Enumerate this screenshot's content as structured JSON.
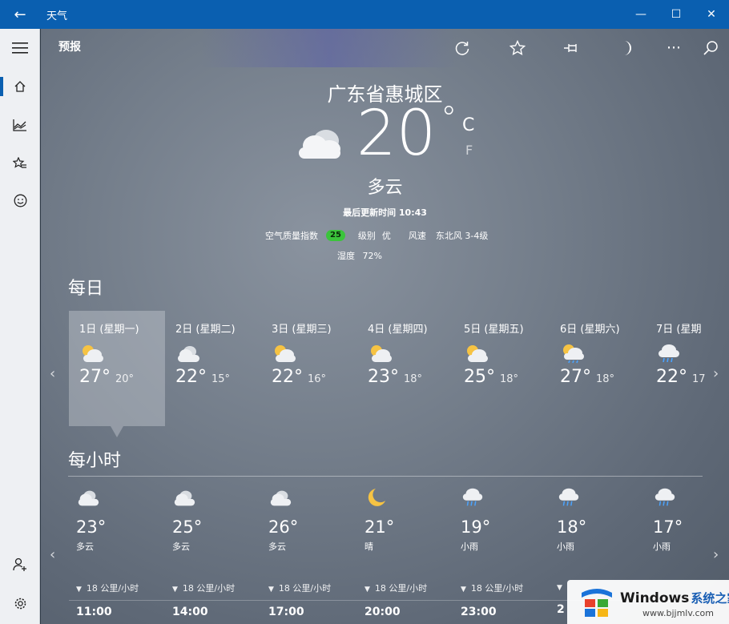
{
  "window": {
    "title": "天气"
  },
  "toolbar": {
    "title": "预报"
  },
  "current": {
    "location": "广东省惠城区",
    "temp": "20",
    "unit_c": "C",
    "unit_f": "F",
    "condition": "多云",
    "updated": "最后更新时间 10:43",
    "aqi_label": "空气质量指数",
    "aqi_value": "25",
    "level_label": "级别",
    "level_value": "优",
    "wind_label": "风速",
    "wind_value": "东北风 3-4级",
    "humidity_label": "湿度",
    "humidity_value": "72%"
  },
  "daily": {
    "title": "每日",
    "days": [
      {
        "label": "1日 (星期一)",
        "icon": "partly-sunny-icon",
        "hi": "27°",
        "lo": "20°"
      },
      {
        "label": "2日 (星期二)",
        "icon": "cloudy-icon",
        "hi": "22°",
        "lo": "15°"
      },
      {
        "label": "3日 (星期三)",
        "icon": "partly-sunny-icon",
        "hi": "22°",
        "lo": "16°"
      },
      {
        "label": "4日 (星期四)",
        "icon": "partly-sunny-icon",
        "hi": "23°",
        "lo": "18°"
      },
      {
        "label": "5日 (星期五)",
        "icon": "partly-sunny-icon",
        "hi": "25°",
        "lo": "18°"
      },
      {
        "label": "6日 (星期六)",
        "icon": "sun-rain-icon",
        "hi": "27°",
        "lo": "18°"
      },
      {
        "label": "7日 (星期",
        "icon": "rain-icon",
        "hi": "22°",
        "lo": "17"
      }
    ]
  },
  "hourly": {
    "title": "每小时",
    "hours": [
      {
        "icon": "cloudy-icon",
        "temp": "23°",
        "desc": "多云",
        "wind": "18 公里/小时",
        "time": "11:00"
      },
      {
        "icon": "cloudy-icon",
        "temp": "25°",
        "desc": "多云",
        "wind": "18 公里/小时",
        "time": "14:00"
      },
      {
        "icon": "cloudy-icon",
        "temp": "26°",
        "desc": "多云",
        "wind": "18 公里/小时",
        "time": "17:00"
      },
      {
        "icon": "moon-icon",
        "temp": "21°",
        "desc": "晴",
        "wind": "18 公里/小时",
        "time": "20:00"
      },
      {
        "icon": "rain-icon",
        "temp": "19°",
        "desc": "小雨",
        "wind": "18 公里/小时",
        "time": "23:00"
      },
      {
        "icon": "rain-icon",
        "temp": "18°",
        "desc": "小雨",
        "wind": "",
        "time": "2"
      },
      {
        "icon": "rain-icon",
        "temp": "17°",
        "desc": "小雨",
        "wind": "",
        "time": ""
      }
    ]
  },
  "watermark": {
    "brand": "Windows",
    "brand_cn": "系统之家",
    "url": "www.bjjmlv.com"
  },
  "colors": {
    "titlebar": "#0a5fb0",
    "aqi_badge": "#3bc43b",
    "nav_bg": "#eef0f3"
  }
}
